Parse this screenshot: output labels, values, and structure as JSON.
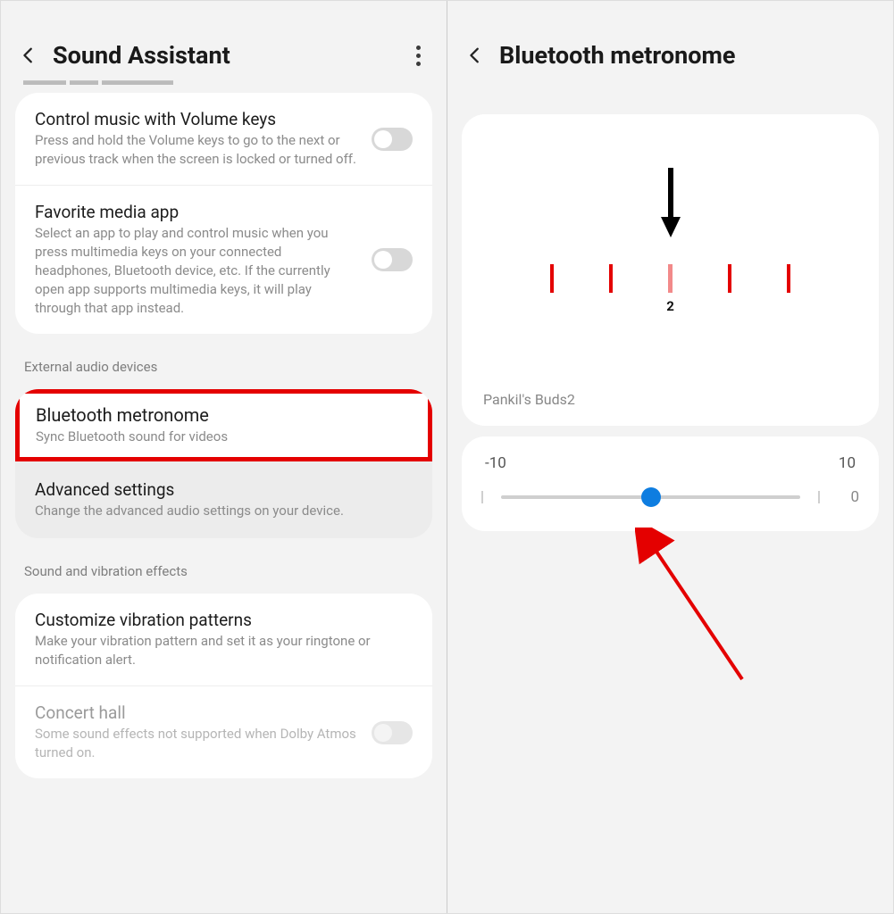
{
  "left": {
    "title": "Sound Assistant",
    "truncated_item": "·····",
    "items": {
      "control_music": {
        "title": "Control music with Volume keys",
        "sub": "Press and hold the Volume keys to go to the next or previous track when the screen is locked or turned off."
      },
      "favorite_media": {
        "title": "Favorite media app",
        "sub": "Select an app to play and control music when you press multimedia keys on your connected headphones, Bluetooth device, etc. If the currently open app supports multimedia keys, it will play through that app instead."
      },
      "ext_audio_label": "External audio devices",
      "bt_metronome": {
        "title": "Bluetooth metronome",
        "sub": "Sync Bluetooth sound for videos"
      },
      "advanced": {
        "title": "Advanced settings",
        "sub": "Change the advanced audio settings on your device."
      },
      "sound_vib_label": "Sound and vibration effects",
      "vibration": {
        "title": "Customize vibration patterns",
        "sub": "Make your vibration pattern and set it as your ringtone or notification alert."
      },
      "concert": {
        "title": "Concert hall",
        "sub": "Some sound effects not supported when Dolby Atmos turned on."
      }
    }
  },
  "right": {
    "title": "Bluetooth metronome",
    "tick_label": "2",
    "device": "Pankil's Buds2",
    "slider": {
      "min": "-10",
      "max": "10",
      "value": "0"
    }
  }
}
